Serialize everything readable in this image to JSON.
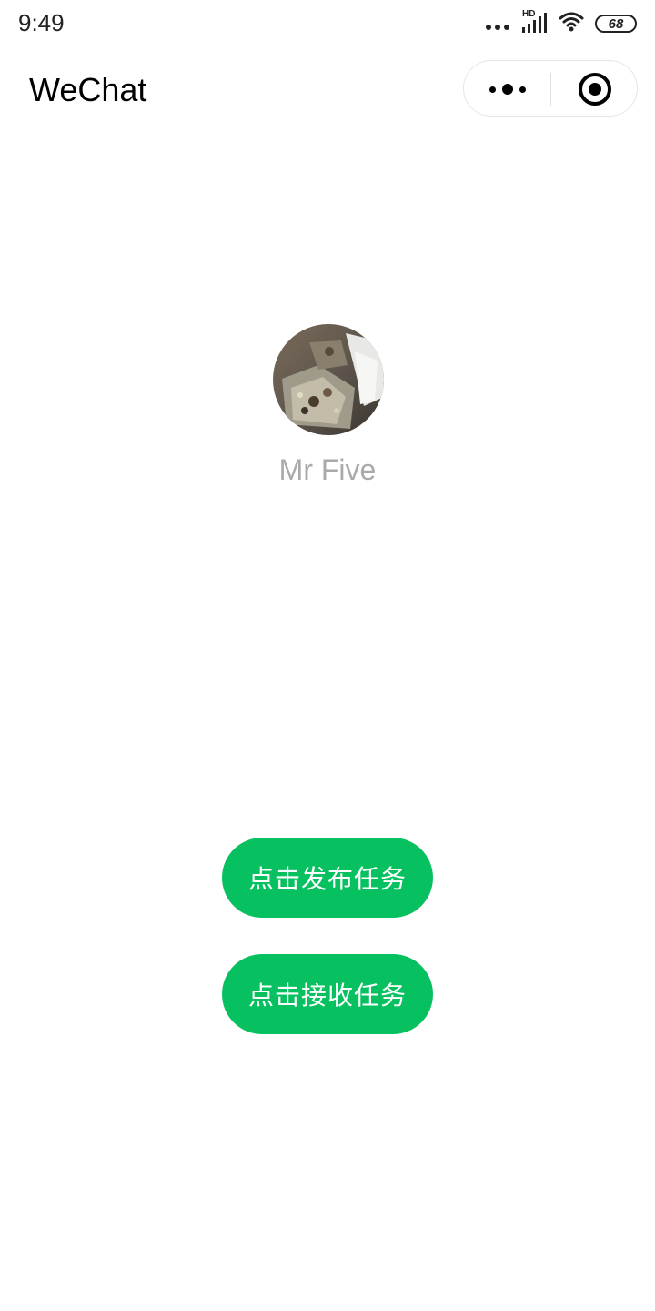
{
  "status_bar": {
    "time": "9:49",
    "network_badge": "HD",
    "battery_level": "68",
    "icons": [
      "more-dots-icon",
      "signal-icon",
      "wifi-icon",
      "battery-icon"
    ]
  },
  "nav": {
    "title": "WeChat",
    "capsule": {
      "more_icon": "more-dots-icon",
      "close_icon": "target-close-icon"
    }
  },
  "profile": {
    "nickname": "Mr Five",
    "avatar": "avatar-photo"
  },
  "actions": {
    "publish_label": "点击发布任务",
    "receive_label": "点击接收任务"
  },
  "colors": {
    "accent": "#07c160",
    "nickname": "#aaaaaa",
    "background": "#ffffff"
  }
}
